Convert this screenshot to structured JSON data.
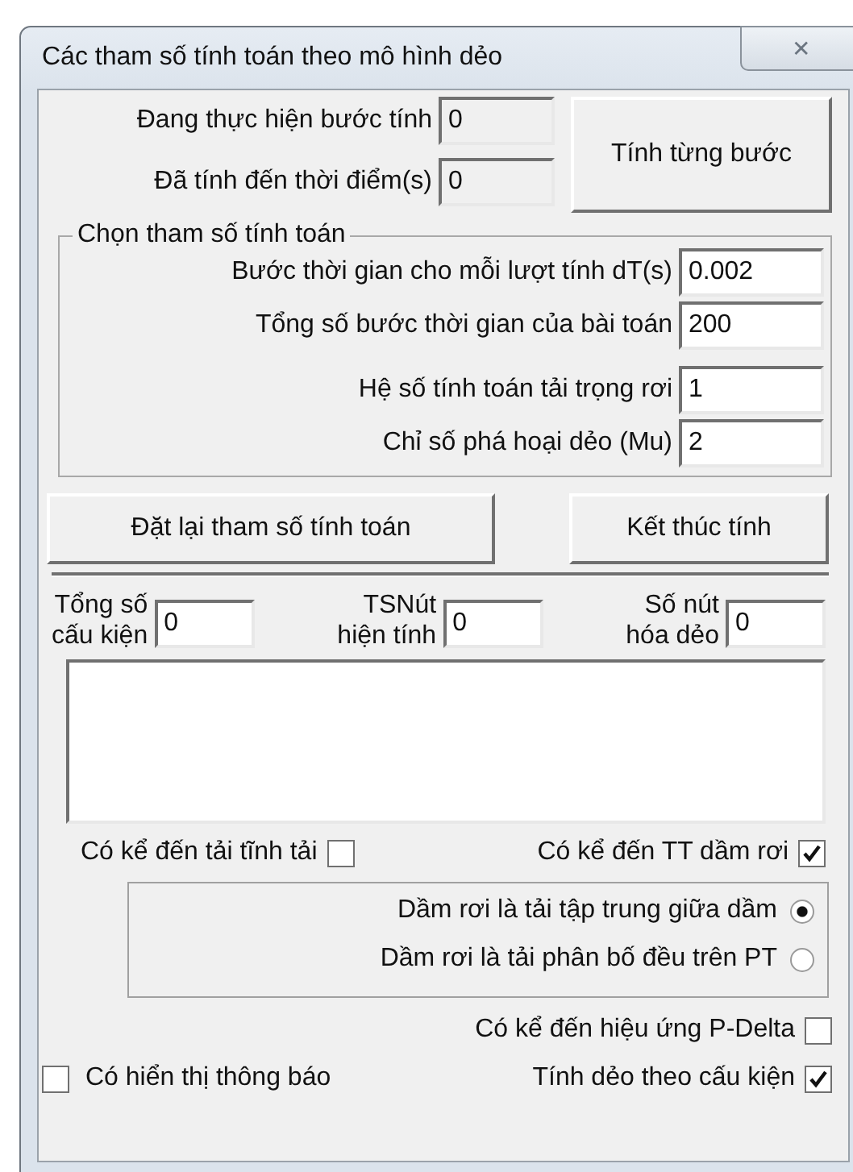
{
  "window": {
    "title": "Các tham số tính toán theo mô hình dẻo",
    "close": "✕"
  },
  "progress_fields": [
    {
      "label": "Đang thực hiện bước tính",
      "value": "0"
    },
    {
      "label": "Đã tính đến thời điểm(s)",
      "value": "0"
    }
  ],
  "step_button": "Tính từng bước",
  "parameters": {
    "legend": "Chọn tham số tính toán",
    "fields": [
      {
        "label": "Bước thời gian cho mỗi lượt tính dT(s)",
        "value": "0.002"
      },
      {
        "label": "Tổng số bước thời gian của bài toán",
        "value": "200"
      },
      {
        "label": "Hệ số tính toán tải trọng rơi",
        "value": "1"
      },
      {
        "label": "Chỉ số phá hoại dẻo (Mu)",
        "value": "2"
      }
    ]
  },
  "buttons": [
    "Đặt lại tham số tính toán",
    "Kết thúc tính"
  ],
  "counters": [
    {
      "label": "Tổng số\ncấu kiện",
      "value": "0"
    },
    {
      "label": "TSNút\nhiện tính",
      "value": "0"
    },
    {
      "label": "Số nút\nhóa dẻo",
      "value": "0"
    }
  ],
  "checks_top": [
    {
      "label": "Có kể đến tải tĩnh tải",
      "checked": false
    },
    {
      "label": "Có kể đến TT dầm rơi",
      "checked": true
    }
  ],
  "drop_load": [
    {
      "label": "Dầm rơi là tải  tập trung giữa dầm",
      "selected": true
    },
    {
      "label": "Dầm rơi là tải phân bố đều trên PT",
      "selected": false
    }
  ],
  "checks_bottom": [
    {
      "label": "Có kể đến hiệu ứng P-Delta",
      "checked": false
    },
    {
      "label": "Có hiển thị thông báo",
      "checked": false
    },
    {
      "label": "Tính dẻo theo cấu kiện",
      "checked": true
    }
  ]
}
